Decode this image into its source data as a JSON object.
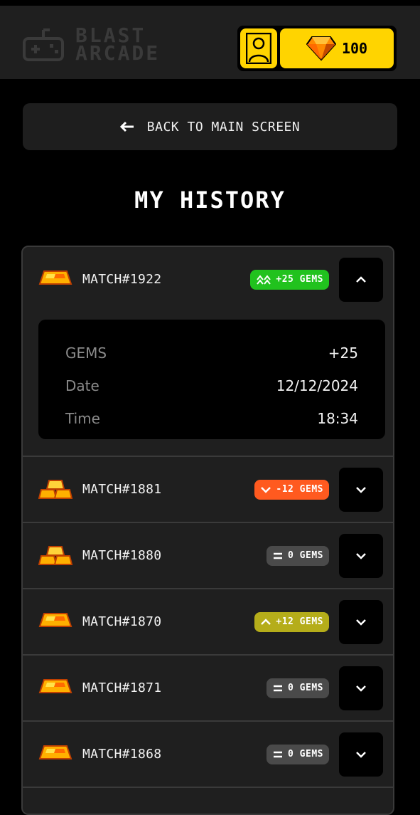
{
  "app": {
    "logo_line1": "BLAST",
    "logo_line2": "ARCADE",
    "gem_balance": "100"
  },
  "back_button": {
    "label": "BACK TO MAIN SCREEN"
  },
  "page_title": "MY HISTORY",
  "colors": {
    "accent": "#ffd400",
    "win": "#21c21e",
    "loss": "#ff5a1f",
    "neutral": "#4a4a4a",
    "small_win": "#b5ad1a"
  },
  "matches": [
    {
      "label": "MATCH#1922",
      "badge": "+25 GEMS",
      "badge_icon": "double-up-icon",
      "badge_kind": "win",
      "expanded": true,
      "details": [
        {
          "key": "GEMS",
          "value": "+25"
        },
        {
          "key": "Date",
          "value": "12/12/2024"
        },
        {
          "key": "Time",
          "value": "18:34"
        }
      ]
    },
    {
      "label": "MATCH#1881",
      "badge": "-12 GEMS",
      "badge_icon": "chevron-down-icon",
      "badge_kind": "loss",
      "expanded": false
    },
    {
      "label": "MATCH#1880",
      "badge": "0 GEMS",
      "badge_icon": "equals-icon",
      "badge_kind": "neutral",
      "expanded": false
    },
    {
      "label": "MATCH#1870",
      "badge": "+12 GEMS",
      "badge_icon": "chevron-up-icon",
      "badge_kind": "small_win",
      "expanded": false
    },
    {
      "label": "MATCH#1871",
      "badge": "0 GEMS",
      "badge_icon": "equals-icon",
      "badge_kind": "neutral",
      "expanded": false
    },
    {
      "label": "MATCH#1868",
      "badge": "0 GEMS",
      "badge_icon": "equals-icon",
      "badge_kind": "neutral",
      "expanded": false
    }
  ]
}
